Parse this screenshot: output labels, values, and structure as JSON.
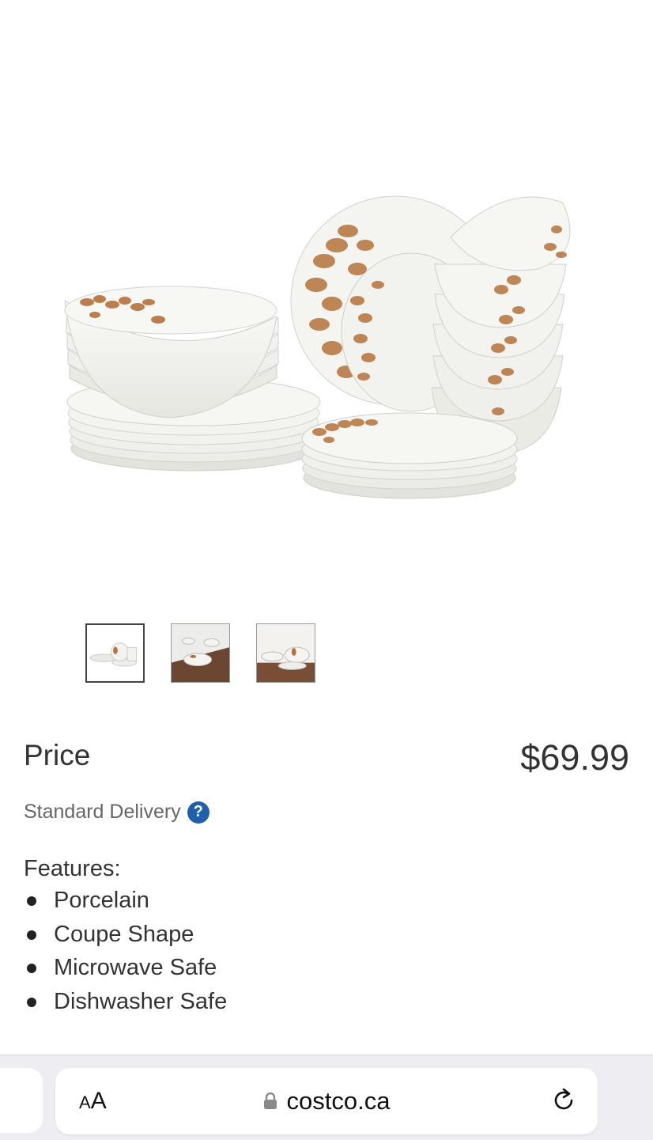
{
  "product_image": {
    "alt": "Porcelain dinnerware set with botanical leaf pattern"
  },
  "thumbnails": [
    {
      "name": "thumbnail-1",
      "active": true
    },
    {
      "name": "thumbnail-2",
      "active": false
    },
    {
      "name": "thumbnail-3",
      "active": false
    }
  ],
  "price": {
    "label": "Price",
    "value": "$69.99"
  },
  "delivery": {
    "label": "Standard Delivery",
    "help_icon": "question-circle-icon",
    "help_glyph": "?"
  },
  "features": {
    "title": "Features:",
    "items": [
      "Porcelain",
      "Coupe Shape",
      "Microwave Safe",
      "Dishwasher Safe"
    ]
  },
  "browser": {
    "text_size_label": "AA",
    "url": "costco.ca",
    "lock_icon": "lock-icon",
    "reload_icon": "reload-icon"
  },
  "colors": {
    "help_blue": "#1f5fad",
    "leaf_brown": "#b5723a",
    "porcelain": "#f6f6f2"
  }
}
